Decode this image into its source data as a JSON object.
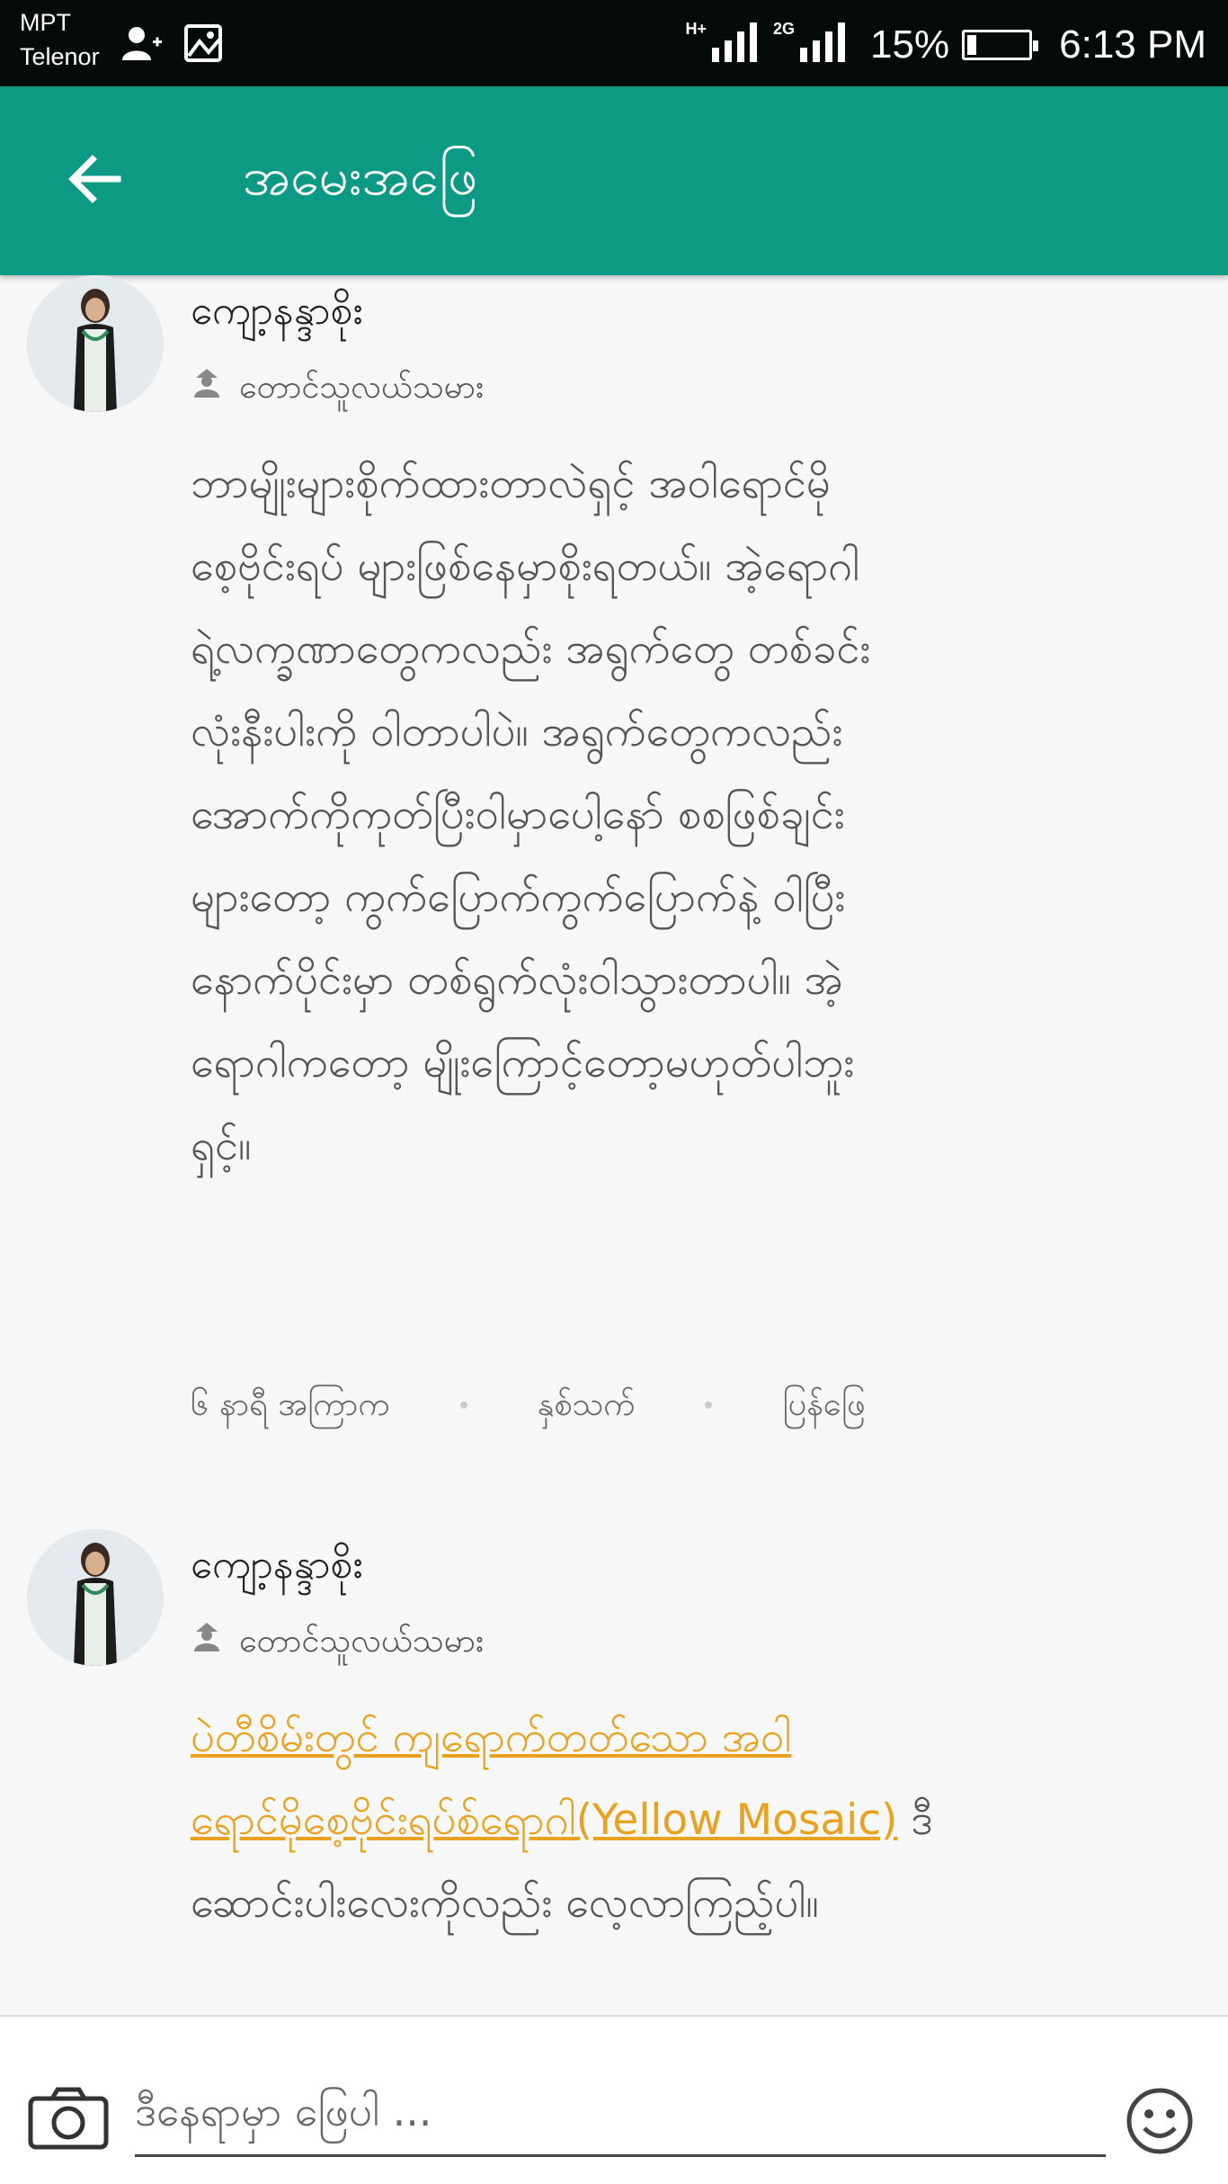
{
  "status_bar": {
    "carrier_top": "MPT",
    "carrier_bottom": "Telenor",
    "network_1": "H+",
    "network_2": "2G",
    "battery_percent": "15%",
    "battery_level": 0.15,
    "time": "6:13 PM",
    "icons": [
      "add-contact-icon",
      "image-notification-icon",
      "signal-icon",
      "signal-icon",
      "battery-icon"
    ]
  },
  "app_bar": {
    "title": "အမေးအဖြေ",
    "back_icon": "arrow-back-icon",
    "color": "#0d9a84"
  },
  "comments": [
    {
      "author": "ကျော့နန္ဒာစိုး",
      "role": "တောင်သူလယ်သမား",
      "role_icon": "farmer-icon",
      "body_lines": [
        "ဘာမျိုးများစိုက်ထားတာလဲရှင့် အဝါရောင်မို",
        "စေ့ဗိုင်းရပ် များဖြစ်နေမှာစိုးရတယ်။ အဲ့ရောဂါ",
        "ရဲ့လက္ခဏာတွေကလည်း အရွက်တွေ တစ်ခင်း",
        "လုံးနီးပါးကို ဝါတာပါပဲ။ အရွက်တွေကလည်း",
        "အောက်ကိုကုတ်ပြီးဝါမှာပေါ့နော် စစဖြစ်ချင်း",
        "များတော့ ကွက်ပြောက်ကွက်ပြောက်နဲ့ ဝါပြီး",
        "နောက်ပိုင်းမှာ တစ်ရွက်လုံးဝါသွားတာပါ။ အဲ့",
        "ရောဂါကတော့ မျိုးကြောင့်တော့မဟုတ်ပါဘူး",
        "ရှင့်။"
      ],
      "time_ago": "၆ နာရီ အကြာက",
      "like_label": "နှစ်သက်",
      "reply_label": "ပြန်ဖြေ"
    },
    {
      "author": "ကျော့နန္ဒာစိုး",
      "role": "တောင်သူလယ်သမား",
      "role_icon": "farmer-icon",
      "link_line_1": "ပဲတီစိမ်းတွင် ကျရောက်တတ်သော အဝါ",
      "link_line_2": "ရောင်မိုစေ့ဗိုင်းရပ်စ်ရောဂါ(Yellow Mosaic)",
      "after_link": " ဒီ",
      "last_line": "ဆောင်းပါးလေးကိုလည်း လေ့လာကြည့်ပါ။",
      "link_color": "#e9a21f"
    }
  ],
  "input_bar": {
    "placeholder": "ဒီနေရာမှာ ဖြေပါ ...",
    "camera_icon": "camera-icon",
    "emoji_icon": "emoji-icon"
  }
}
